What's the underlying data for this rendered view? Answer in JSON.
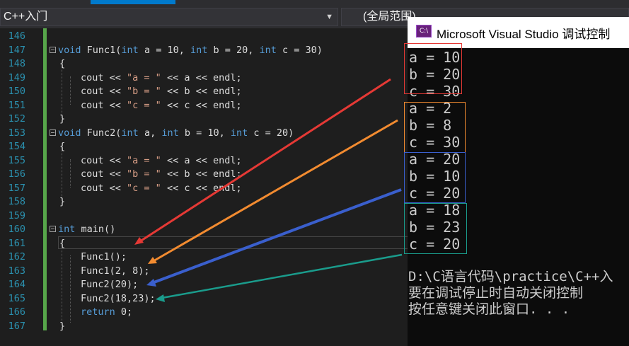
{
  "toolbar": {
    "project_combo": "C++入门",
    "scope_combo": "(全局范围)"
  },
  "line_numbers": [
    "146",
    "147",
    "148",
    "149",
    "150",
    "151",
    "152",
    "153",
    "154",
    "155",
    "156",
    "157",
    "158",
    "159",
    "160",
    "161",
    "162",
    "163",
    "164",
    "165",
    "166",
    "167"
  ],
  "code": {
    "l147": {
      "kw1": "void",
      "fn": " Func1(",
      "kw2": "int",
      "t2": " a = 10, ",
      "kw3": "int",
      "t3": " b = 20, ",
      "kw4": "int",
      "t4": " c = 30)"
    },
    "brace_open": "{",
    "brace_close": "}",
    "cout": "cout << ",
    "lbl_a": "\"a = \"",
    "lbl_b": "\"b = \"",
    "lbl_c": "\"c = \"",
    "tail_a": " << a << endl;",
    "tail_b": " << b << endl;",
    "tail_c": " << c << endl;",
    "l153": {
      "kw1": "void",
      "fn": " Func2(",
      "kw2": "int",
      "t2": " a, ",
      "kw3": "int",
      "t3": " b = 10, ",
      "kw4": "int",
      "t4": " c = 20)"
    },
    "l160": {
      "kw": "int",
      "rest": " main()"
    },
    "call1": "Func1();",
    "call2": "Func1(2, 8);",
    "call3": "Func2(20);",
    "call4": "Func2(18,23);",
    "ret_kw": "return",
    "ret_rest": " 0;"
  },
  "console": {
    "title": "Microsoft Visual Studio 调试控制",
    "icon": "C:\\",
    "output": [
      "a = 10",
      "b = 20",
      "c = 30",
      "a = 2",
      "b = 8",
      "c = 30",
      "a = 20",
      "b = 10",
      "c = 20",
      "a = 18",
      "b = 23",
      "c = 20"
    ],
    "prompt": [
      "D:\\C语言代码\\practice\\C++入",
      "要在调试停止时自动关闭控制",
      "按任意键关闭此窗口. . ."
    ]
  },
  "colors": {
    "group1": "#e53935",
    "group2": "#f28b30",
    "group3": "#3a5fcd",
    "group4": "#1a9c8c"
  }
}
